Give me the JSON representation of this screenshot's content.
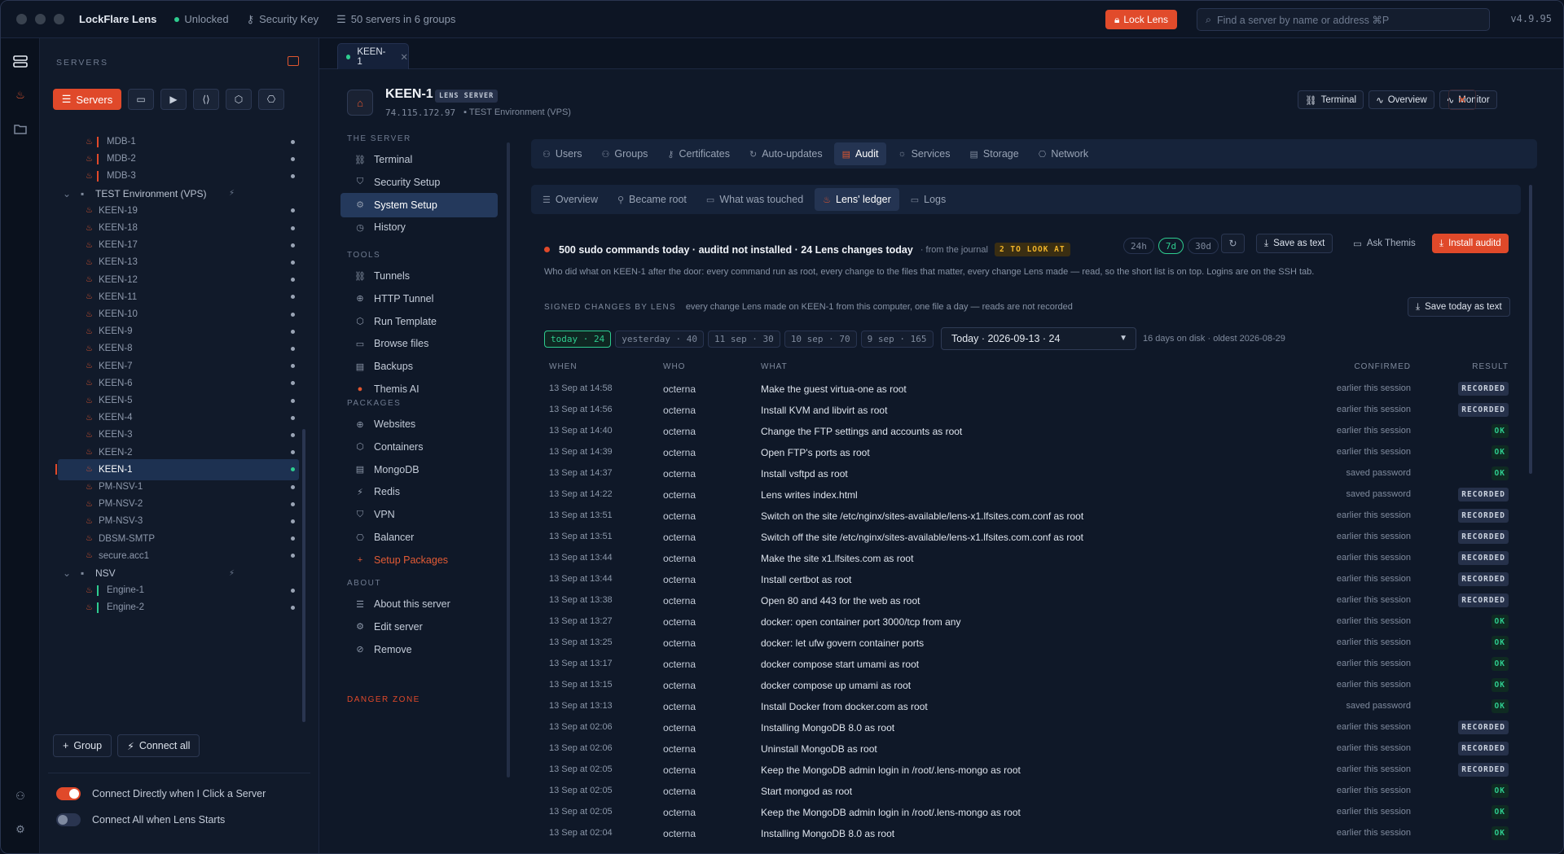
{
  "titlebar": {
    "app_name": "LockFlare Lens",
    "status": "Unlocked",
    "security_key": "Security Key",
    "servers_summary": "50 servers in 6 groups",
    "lock_label": "Lock Lens",
    "search_placeholder": "Find a server by name or address  ⌘P",
    "version": "v4.9.95"
  },
  "sidebar": {
    "title": "SERVERS",
    "servers_button": "Servers",
    "tree": [
      {
        "label": "MDB-1",
        "kind": "server",
        "bar": "#e0492a"
      },
      {
        "label": "MDB-2",
        "kind": "server",
        "bar": "#e0492a"
      },
      {
        "label": "MDB-3",
        "kind": "server",
        "bar": "#e0492a"
      },
      {
        "label": "TEST Environment (VPS)",
        "kind": "group"
      },
      {
        "label": "KEEN-19",
        "kind": "server"
      },
      {
        "label": "KEEN-18",
        "kind": "server"
      },
      {
        "label": "KEEN-17",
        "kind": "server"
      },
      {
        "label": "KEEN-13",
        "kind": "server"
      },
      {
        "label": "KEEN-12",
        "kind": "server"
      },
      {
        "label": "KEEN-11",
        "kind": "server"
      },
      {
        "label": "KEEN-10",
        "kind": "server"
      },
      {
        "label": "KEEN-9",
        "kind": "server"
      },
      {
        "label": "KEEN-8",
        "kind": "server"
      },
      {
        "label": "KEEN-7",
        "kind": "server"
      },
      {
        "label": "KEEN-6",
        "kind": "server"
      },
      {
        "label": "KEEN-5",
        "kind": "server"
      },
      {
        "label": "KEEN-4",
        "kind": "server"
      },
      {
        "label": "KEEN-3",
        "kind": "server"
      },
      {
        "label": "KEEN-2",
        "kind": "server"
      },
      {
        "label": "KEEN-1",
        "kind": "server",
        "selected": true
      },
      {
        "label": "PM-NSV-1",
        "kind": "server"
      },
      {
        "label": "PM-NSV-2",
        "kind": "server"
      },
      {
        "label": "PM-NSV-3",
        "kind": "server"
      },
      {
        "label": "DBSM-SMTP",
        "kind": "server"
      },
      {
        "label": "secure.acc1",
        "kind": "server"
      },
      {
        "label": "NSV",
        "kind": "group"
      },
      {
        "label": "Engine-1",
        "kind": "server",
        "bar": "#2ecc8f"
      },
      {
        "label": "Engine-2",
        "kind": "server",
        "bar": "#2ecc8f"
      }
    ],
    "group_button": "Group",
    "connect_all_button": "Connect all",
    "toggle_connect_directly": "Connect Directly when I Click a Server",
    "toggle_connect_all": "Connect All when Lens Starts"
  },
  "tab": {
    "label": "KEEN-1"
  },
  "server": {
    "name": "KEEN-1",
    "badge": "LENS SERVER",
    "address": "74.115.172.97",
    "group": "TEST Environment (VPS)",
    "buttons": {
      "terminal": "Terminal",
      "overview": "Overview",
      "monitor": "Monitor"
    }
  },
  "secnav": {
    "the_server_heading": "THE SERVER",
    "the_server": [
      "Terminal",
      "Security Setup",
      "System Setup",
      "History"
    ],
    "tools_heading": "TOOLS",
    "tools": [
      "Tunnels",
      "HTTP Tunnel",
      "Run Template",
      "Browse files",
      "Backups",
      "Themis AI"
    ],
    "packages_heading": "PACKAGES",
    "packages": [
      "Websites",
      "Containers",
      "MongoDB",
      "Redis",
      "VPN",
      "Balancer",
      "Setup Packages"
    ],
    "about_heading": "ABOUT",
    "about": [
      "About this server",
      "Edit server",
      "Remove"
    ],
    "danger_heading": "DANGER ZONE"
  },
  "top_tabs": [
    "Users",
    "Groups",
    "Certificates",
    "Auto-updates",
    "Audit",
    "Services",
    "Storage",
    "Network"
  ],
  "sub_tabs": [
    "Overview",
    "Became root",
    "What was touched",
    "Lens' ledger",
    "Logs"
  ],
  "alert": {
    "text": "500 sudo commands today · auditd not installed · 24 Lens changes today",
    "source": "· from the journal",
    "look": "2 TO LOOK AT",
    "ranges": [
      "24h",
      "7d",
      "30d"
    ],
    "save_text": "Save as text",
    "ask": "Ask Themis",
    "install": "Install auditd",
    "description": "Who did what on KEEN-1 after the door: every command run as root, every change to the files that matter, every change Lens made — read, so the short list is on top. Logins are on the SSH tab."
  },
  "signed": {
    "heading": "SIGNED CHANGES BY LENS",
    "note": "every change Lens made on KEEN-1 from this computer, one file a day — reads are not recorded",
    "save_today": "Save today as text",
    "days": [
      "today · 24",
      "yesterday · 40",
      "11 sep · 30",
      "10 sep · 70",
      "9 sep · 165"
    ],
    "selected_day": "Today · 2026-09-13 · 24",
    "disk": "16 days on disk · oldest 2026-08-29"
  },
  "table": {
    "headers": {
      "when": "WHEN",
      "who": "WHO",
      "what": "WHAT",
      "confirmed": "CONFIRMED",
      "result": "RESULT"
    },
    "rows": [
      {
        "when": "13 Sep at 14:58",
        "who": "octerna",
        "what": "Make the guest virtua-one as root",
        "confirmed": "earlier this session",
        "result": "RECORDED"
      },
      {
        "when": "13 Sep at 14:56",
        "who": "octerna",
        "what": "Install KVM and libvirt as root",
        "confirmed": "earlier this session",
        "result": "RECORDED"
      },
      {
        "when": "13 Sep at 14:40",
        "who": "octerna",
        "what": "Change the FTP settings and accounts as root",
        "confirmed": "earlier this session",
        "result": "OK"
      },
      {
        "when": "13 Sep at 14:39",
        "who": "octerna",
        "what": "Open FTP's ports as root",
        "confirmed": "earlier this session",
        "result": "OK"
      },
      {
        "when": "13 Sep at 14:37",
        "who": "octerna",
        "what": "Install vsftpd as root",
        "confirmed": "saved password",
        "result": "OK"
      },
      {
        "when": "13 Sep at 14:22",
        "who": "octerna",
        "what": "Lens writes index.html",
        "confirmed": "saved password",
        "result": "RECORDED"
      },
      {
        "when": "13 Sep at 13:51",
        "who": "octerna",
        "what": "Switch on the site /etc/nginx/sites-available/lens-x1.lfsites.com.conf as root",
        "confirmed": "earlier this session",
        "result": "RECORDED"
      },
      {
        "when": "13 Sep at 13:51",
        "who": "octerna",
        "what": "Switch off the site /etc/nginx/sites-available/lens-x1.lfsites.com.conf as root",
        "confirmed": "earlier this session",
        "result": "RECORDED"
      },
      {
        "when": "13 Sep at 13:44",
        "who": "octerna",
        "what": "Make the site x1.lfsites.com as root",
        "confirmed": "earlier this session",
        "result": "RECORDED"
      },
      {
        "when": "13 Sep at 13:44",
        "who": "octerna",
        "what": "Install certbot as root",
        "confirmed": "earlier this session",
        "result": "RECORDED"
      },
      {
        "when": "13 Sep at 13:38",
        "who": "octerna",
        "what": "Open 80 and 443 for the web as root",
        "confirmed": "earlier this session",
        "result": "RECORDED"
      },
      {
        "when": "13 Sep at 13:27",
        "who": "octerna",
        "what": "docker: open container port 3000/tcp from any",
        "confirmed": "earlier this session",
        "result": "OK"
      },
      {
        "when": "13 Sep at 13:25",
        "who": "octerna",
        "what": "docker: let ufw govern container ports",
        "confirmed": "earlier this session",
        "result": "OK"
      },
      {
        "when": "13 Sep at 13:17",
        "who": "octerna",
        "what": "docker compose start umami as root",
        "confirmed": "earlier this session",
        "result": "OK"
      },
      {
        "when": "13 Sep at 13:15",
        "who": "octerna",
        "what": "docker compose up umami as root",
        "confirmed": "earlier this session",
        "result": "OK"
      },
      {
        "when": "13 Sep at 13:13",
        "who": "octerna",
        "what": "Install Docker from docker.com as root",
        "confirmed": "saved password",
        "result": "OK"
      },
      {
        "when": "13 Sep at 02:06",
        "who": "octerna",
        "what": "Installing MongoDB 8.0 as root",
        "confirmed": "earlier this session",
        "result": "RECORDED"
      },
      {
        "when": "13 Sep at 02:06",
        "who": "octerna",
        "what": "Uninstall MongoDB as root",
        "confirmed": "earlier this session",
        "result": "RECORDED"
      },
      {
        "when": "13 Sep at 02:05",
        "who": "octerna",
        "what": "Keep the MongoDB admin login in /root/.lens-mongo as root",
        "confirmed": "earlier this session",
        "result": "RECORDED"
      },
      {
        "when": "13 Sep at 02:05",
        "who": "octerna",
        "what": "Start mongod as root",
        "confirmed": "earlier this session",
        "result": "OK"
      },
      {
        "when": "13 Sep at 02:05",
        "who": "octerna",
        "what": "Keep the MongoDB admin login in /root/.lens-mongo as root",
        "confirmed": "earlier this session",
        "result": "OK"
      },
      {
        "when": "13 Sep at 02:04",
        "who": "octerna",
        "what": "Installing MongoDB 8.0 as root",
        "confirmed": "earlier this session",
        "result": "OK"
      }
    ]
  }
}
